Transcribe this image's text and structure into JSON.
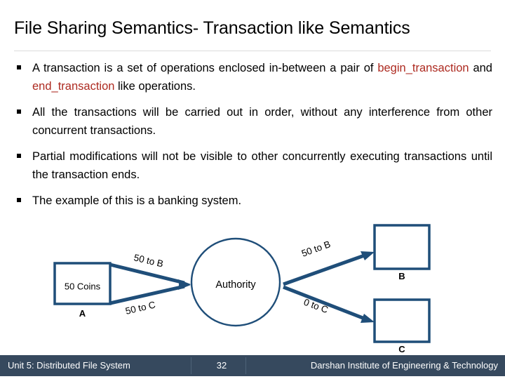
{
  "slide": {
    "title": "File Sharing Semantics- Transaction like Semantics",
    "accent_red": "#ad2a20",
    "diagram_blue": "#1f4e79",
    "footer_bg": "#36495e"
  },
  "bullets": [
    {
      "marker": "square-bullet",
      "part1": "A transaction is a set of operations enclosed in-between a pair of ",
      "kw1": "begin_transaction",
      "part2": " and ",
      "kw2": "end_transaction",
      "part3": " like operations."
    },
    {
      "marker": "square-bullet",
      "text": "All the transactions will be carried out in order, without any interference from other concurrent transactions."
    },
    {
      "marker": "square-bullet",
      "text": "Partial modifications will not be visible to other concurrently executing transactions until the transaction ends."
    },
    {
      "marker": "square-bullet",
      "text": "The example of this is a banking system."
    }
  ],
  "diagram": {
    "node_a_text": "50 Coins",
    "node_a_label": "A",
    "node_authority_label": "Authority",
    "node_b_text": "",
    "node_b_label": "B",
    "node_c_text": "",
    "node_c_label": "C",
    "edge_a_to_authority_top": "50 to B",
    "edge_a_to_authority_bottom": "50 to C",
    "edge_authority_to_b": "50 to B",
    "edge_authority_to_c": "0 to C"
  },
  "footer": {
    "left": "Unit 5: Distributed File System",
    "page": "32",
    "right": "Darshan Institute of Engineering & Technology"
  }
}
